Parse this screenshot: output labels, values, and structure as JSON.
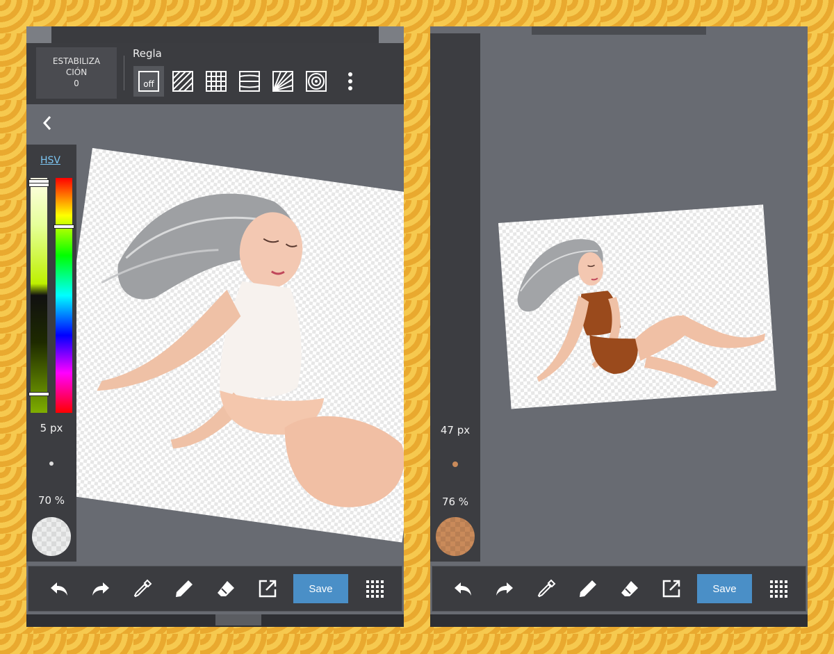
{
  "left_screen": {
    "stabilization": {
      "line1": "ESTABILIZA",
      "line2": "CIÓN",
      "value": "0"
    },
    "ruler": {
      "title": "Regla",
      "options": [
        {
          "icon": "ruler-off-icon",
          "label": "off",
          "selected": true
        },
        {
          "icon": "parallel-lines-icon"
        },
        {
          "icon": "grid-icon"
        },
        {
          "icon": "perspective-lines-icon"
        },
        {
          "icon": "radial-lines-icon"
        },
        {
          "icon": "concentric-circles-icon"
        }
      ],
      "more_icon": "more-vertical-icon"
    },
    "back_icon": "chevron-left-icon",
    "color_panel": {
      "mode": "HSV",
      "brush_size": "5 px",
      "opacity": "70 %",
      "color": "#f0f0f0"
    },
    "toolbar": {
      "save_label": "Save",
      "icons": [
        "undo-icon",
        "redo-icon",
        "eyedropper-icon",
        "pen-icon",
        "eraser-icon",
        "export-icon",
        "grid-menu-icon"
      ]
    }
  },
  "right_screen": {
    "color_panel": {
      "brush_size": "47 px",
      "opacity": "76 %",
      "color": "#c98a5a"
    },
    "toolbar": {
      "save_label": "Save",
      "icons": [
        "undo-icon",
        "redo-icon",
        "eyedropper-icon",
        "pen-icon",
        "eraser-icon",
        "export-icon",
        "grid-menu-icon"
      ]
    }
  },
  "colors": {
    "background": "#f0b63e",
    "canvas_area": "#686b72",
    "toolbar": "#3b3c40",
    "save_button": "#4a8fc7",
    "hsv_link": "#7cc4f0",
    "skin": "#f2c6ae",
    "hair": "#b9bbbd",
    "clothes": "#9a4a1c"
  }
}
